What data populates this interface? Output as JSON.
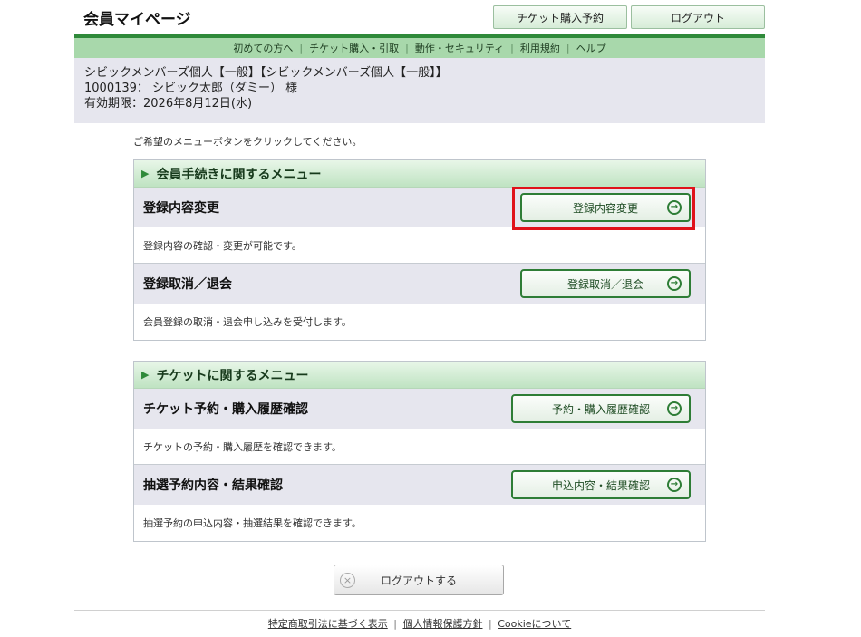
{
  "header": {
    "title": "会員マイページ",
    "ticket_button": "チケット購入予約",
    "logout_button": "ログアウト"
  },
  "nav": {
    "items": [
      "初めての方へ",
      "チケット購入・引取",
      "動作・セキュリティ",
      "利用規約",
      "ヘルプ"
    ]
  },
  "user": {
    "membership": "シビックメンバーズ個人【一般】【シビックメンバーズ個人【一般】】",
    "member_line": "1000139： シビック太郎（ダミー） 様",
    "expiry": "有効期限：2026年8月12日(水)"
  },
  "instruction": "ご希望のメニューボタンをクリックしてください。",
  "sections": [
    {
      "heading": "会員手続きに関するメニュー",
      "items": [
        {
          "title": "登録内容変更",
          "button": "登録内容変更",
          "desc": "登録内容の確認・変更が可能です。"
        },
        {
          "title": "登録取消／退会",
          "button": "登録取消／退会",
          "desc": "会員登録の取消・退会申し込みを受付します。"
        }
      ]
    },
    {
      "heading": "チケットに関するメニュー",
      "items": [
        {
          "title": "チケット予約・購入履歴確認",
          "button": "予約・購入履歴確認",
          "desc": "チケットの予約・購入履歴を確認できます。"
        },
        {
          "title": "抽選予約内容・結果確認",
          "button": "申込内容・結果確認",
          "desc": "抽選予約の申込内容・抽選結果を確認できます。"
        }
      ]
    }
  ],
  "logout_big": "ログアウトする",
  "footer": {
    "links": [
      "特定商取引法に基づく表示",
      "個人情報保護方針",
      "Cookieについて"
    ]
  },
  "colors": {
    "accent_green": "#2f8a3a",
    "nav_green": "#a8d8ab",
    "highlight_red": "#e0121b"
  }
}
